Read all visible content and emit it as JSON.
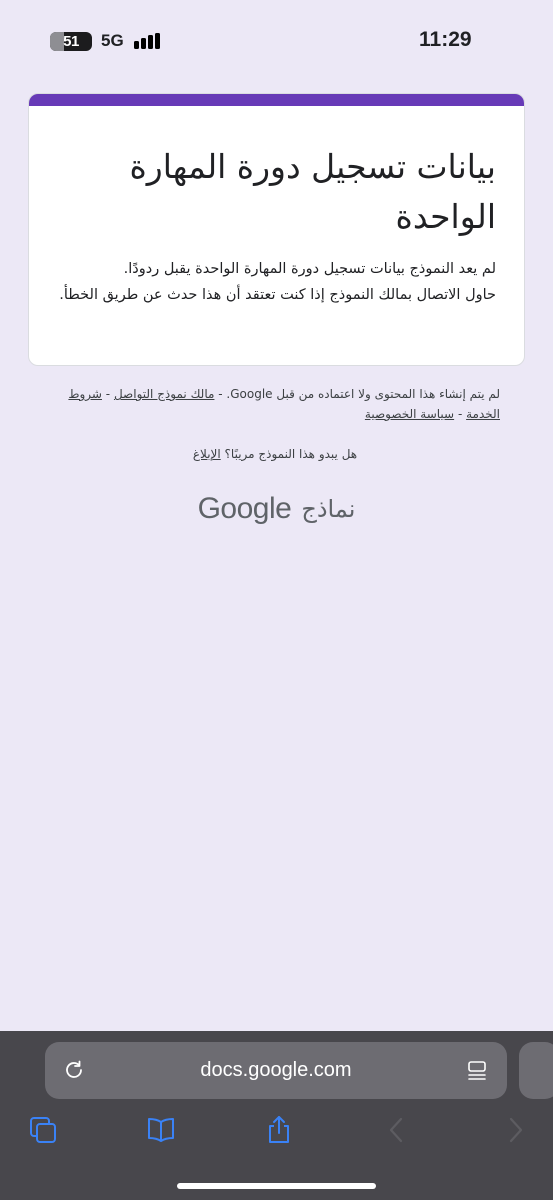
{
  "status_bar": {
    "battery": "51",
    "network": "5G",
    "time": "11:29"
  },
  "form": {
    "title": "بيانات تسجيل دورة المهارة الواحدة",
    "message_line1": "لم يعد النموذج بيانات تسجيل دورة المهارة الواحدة  يقبل ردودًا.",
    "message_line2": "حاول الاتصال بمالك النموذج إذا كنت تعتقد أن هذا حدث عن طريق الخطأ."
  },
  "footer": {
    "notice": "لم يتم إنشاء هذا المحتوى ولا اعتماده من قبل Google. -",
    "owner_link": "مالك نموذج التواصل",
    "sep1": " - ",
    "terms_link": "شروط الخدمة",
    "sep2": " - ",
    "privacy_link": "سياسة الخصوصية",
    "report_question": "هل يبدو هذا النموذج مريبًا؟",
    "report_link": "الإبلاغ"
  },
  "brand": {
    "google": "Google",
    "forms": "نماذج"
  },
  "browser": {
    "url": "docs.google.com"
  },
  "colors": {
    "accent": "#673ab7",
    "background": "#ece8f6",
    "toolbar": "#48474c",
    "toolbar_icon": "#3a82f6"
  },
  "icons": {
    "reload": "reload-icon",
    "reader": "reader-mode-icon",
    "tabs": "tabs-icon",
    "bookmarks": "bookmarks-icon",
    "share": "share-icon",
    "back": "back-icon",
    "forward": "forward-icon"
  }
}
